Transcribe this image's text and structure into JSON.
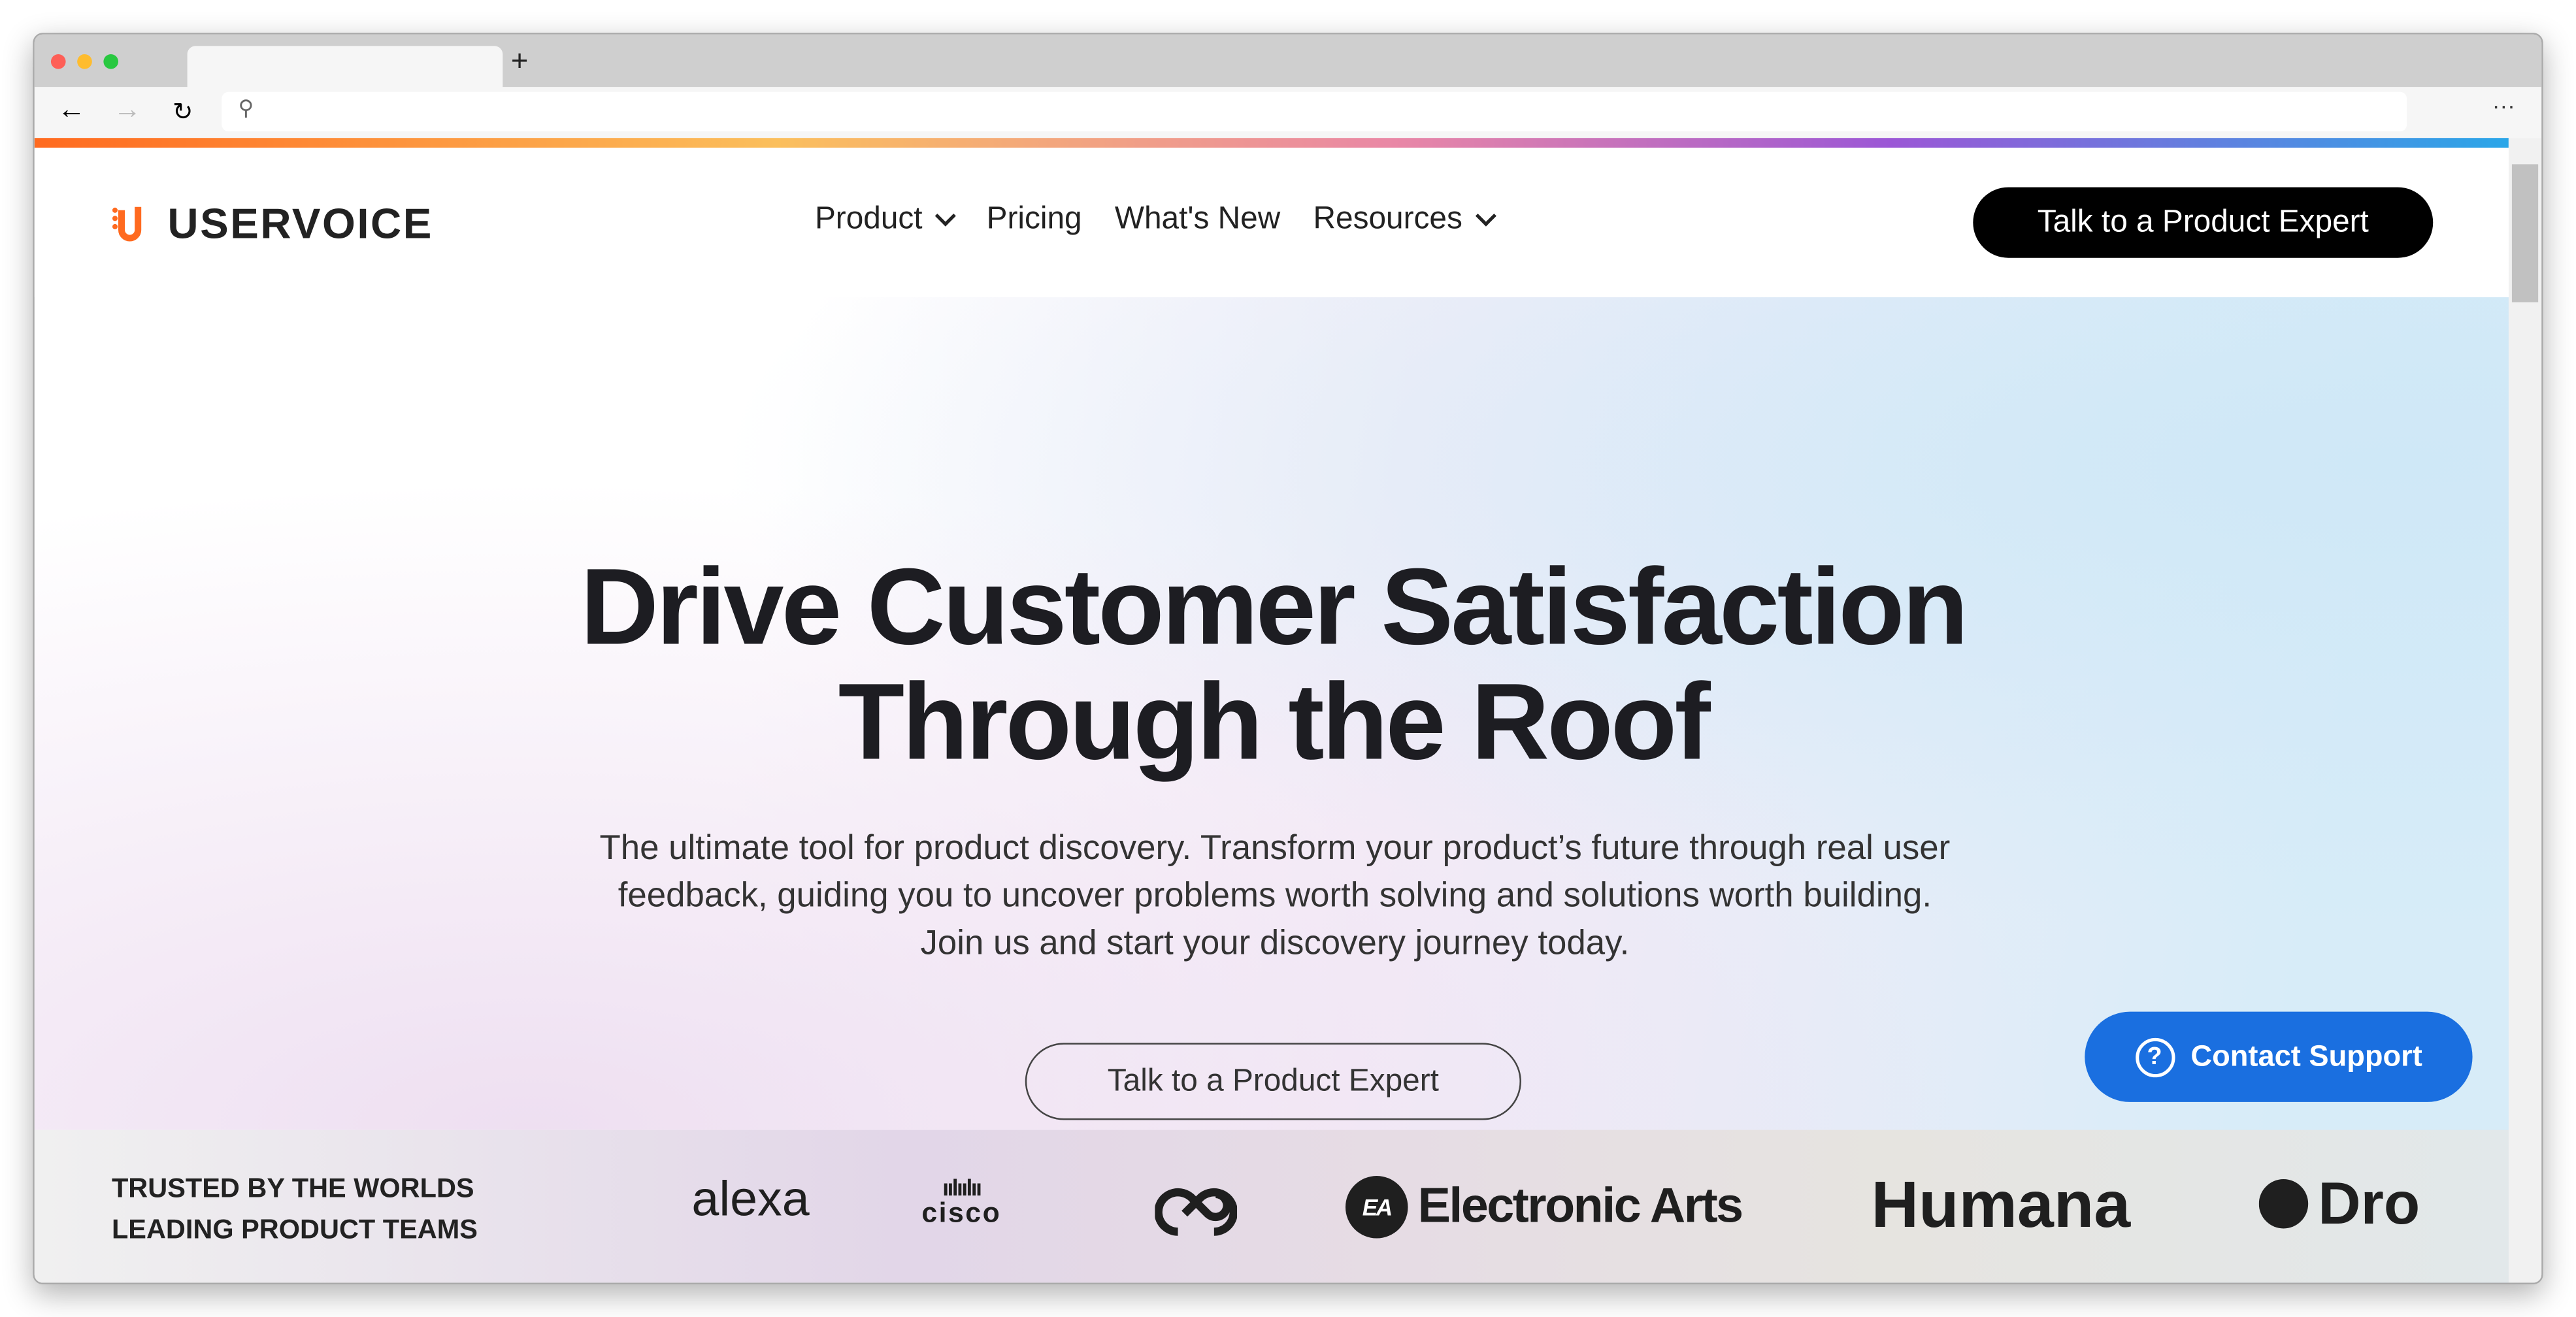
{
  "browser": {
    "new_tab": "+",
    "more": "···"
  },
  "nav": {
    "logo": "USERVOICE",
    "items": [
      {
        "label": "Product",
        "dropdown": true
      },
      {
        "label": "Pricing"
      },
      {
        "label": "What's New"
      },
      {
        "label": "Resources",
        "dropdown": true
      }
    ],
    "cta": "Talk to a Product Expert"
  },
  "hero": {
    "title_line1": "Drive Customer Satisfaction",
    "title_line2": "Through the Roof",
    "subtitle_line1": "The ultimate tool for product discovery. Transform your product’s future through real user",
    "subtitle_line2": "feedback, guiding you to uncover problems worth solving and solutions worth building.",
    "subtitle_line3": "Join us and start your discovery journey today.",
    "button": "Talk to a Product Expert"
  },
  "support": {
    "label": "Contact Support"
  },
  "trusted": {
    "line1": "TRUSTED BY THE WORLDS",
    "line2": "LEADING PRODUCT TEAMS",
    "logos": [
      "alexa",
      "cisco",
      "Adobe Creative Cloud",
      "Electronic Arts",
      "Humana",
      "Dro"
    ]
  },
  "colors": {
    "brand": "#ff6a1f",
    "cta": "#000000",
    "support": "#1a6fe0"
  }
}
